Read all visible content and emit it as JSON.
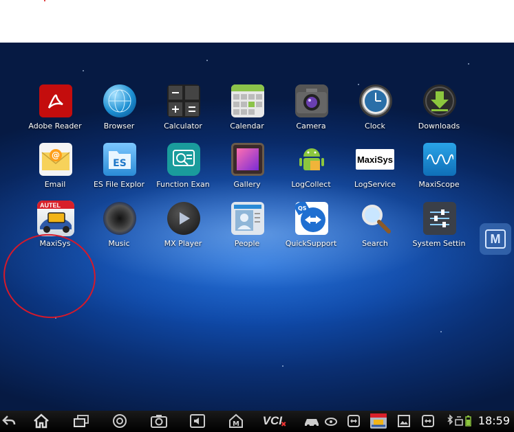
{
  "apps": [
    {
      "label": "Adobe Reader",
      "icon": "adobe-reader-icon"
    },
    {
      "label": "Browser",
      "icon": "browser-globe-icon"
    },
    {
      "label": "Calculator",
      "icon": "calculator-icon"
    },
    {
      "label": "Calendar",
      "icon": "calendar-icon"
    },
    {
      "label": "Camera",
      "icon": "camera-icon"
    },
    {
      "label": "Clock",
      "icon": "clock-icon"
    },
    {
      "label": "Downloads",
      "icon": "downloads-icon"
    },
    {
      "label": "Email",
      "icon": "email-icon"
    },
    {
      "label": "ES File Explor",
      "icon": "es-file-explorer-icon"
    },
    {
      "label": "Function Exan",
      "icon": "function-exam-icon"
    },
    {
      "label": "Gallery",
      "icon": "gallery-icon"
    },
    {
      "label": "LogCollect",
      "icon": "android-icon"
    },
    {
      "label": "LogService",
      "icon": "maxisys-logo-icon",
      "icon_text": "MaxiSys"
    },
    {
      "label": "MaxiScope",
      "icon": "maxiscope-icon"
    },
    {
      "label": "MaxiSys",
      "icon": "maxisys-app-icon",
      "icon_text": "AUTEL"
    },
    {
      "label": "Music",
      "icon": "speaker-icon"
    },
    {
      "label": "MX Player",
      "icon": "play-icon"
    },
    {
      "label": "People",
      "icon": "people-icon"
    },
    {
      "label": "QuickSupport",
      "icon": "quicksupport-icon",
      "icon_text": "QS"
    },
    {
      "label": "Search",
      "icon": "magnifier-icon"
    },
    {
      "label": "System Settin",
      "icon": "settings-sliders-icon"
    }
  ],
  "floating_button": {
    "label": "M"
  },
  "status": {
    "time": "18:59",
    "vci_label": "VCI"
  },
  "colors": {
    "annotation_circle": "#d6192a",
    "navbar": "#000000"
  }
}
